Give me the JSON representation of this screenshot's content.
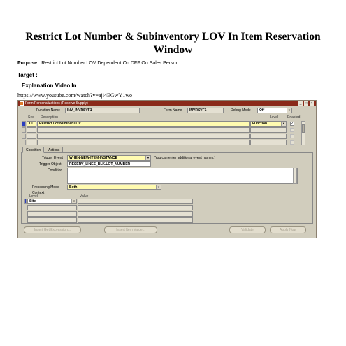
{
  "doc": {
    "title": "Restrict Lot Number & Subinventory LOV In Item Reservation Window",
    "purpose_label": "Purpose :",
    "purpose_text": "Restrict Lot Number LOV Dependent On DFF On Sales Person",
    "target_label": "Target :",
    "explanation_label": "Explanation Video In",
    "video_url": "https://www.youtube.com/watch?v=aji4EGwY1wo"
  },
  "window": {
    "title": "Form Personalizations (Reserve Supply)",
    "title_buttons": [
      "_",
      "□",
      "×"
    ],
    "header": {
      "function_name_label": "Function Name",
      "function_name_value": "INV_INVRSVF1",
      "form_name_label": "Form Name",
      "form_name_value": "INVRSVF1",
      "debug_mode_label": "Debug Mode",
      "debug_mode_value": "Off"
    },
    "rules_grid": {
      "columns": {
        "seq": "Seq",
        "description": "Description",
        "level": "Level",
        "enabled": "Enabled"
      },
      "rows": [
        {
          "seq": "10",
          "description": "Restrict Lot Number LOV",
          "level": "Function",
          "enabled": true
        },
        {
          "seq": "",
          "description": "",
          "level": "",
          "enabled": false
        },
        {
          "seq": "",
          "description": "",
          "level": "",
          "enabled": false
        },
        {
          "seq": "",
          "description": "",
          "level": "",
          "enabled": false
        }
      ]
    },
    "tabs": [
      {
        "label": "Condition",
        "active": true
      },
      {
        "label": "Actions",
        "active": false
      }
    ],
    "condition": {
      "trigger_event_label": "Trigger Event",
      "trigger_event_value": "WHEN-NEW-ITEM-INSTANCE",
      "trigger_event_hint": "(You can enter additional event names.)",
      "trigger_object_label": "Trigger Object",
      "trigger_object_value": "RESERV_LINES_BLK.LOT_NUMBER",
      "condition_label": "Condition",
      "condition_value": "",
      "processing_mode_label": "Processing Mode",
      "processing_mode_value": "Both",
      "context_label": "Context",
      "context_columns": {
        "level": "Level",
        "value": "Value"
      },
      "context_rows": [
        {
          "level": "Site",
          "value": ""
        },
        {
          "level": "",
          "value": ""
        },
        {
          "level": "",
          "value": ""
        },
        {
          "level": "",
          "value": ""
        }
      ]
    },
    "buttons": {
      "insert_get_expression": "Insert Get Expression...",
      "insert_item_value": "Insert Item Value...",
      "validate": "Validate",
      "apply_now": "Apply Now"
    }
  }
}
